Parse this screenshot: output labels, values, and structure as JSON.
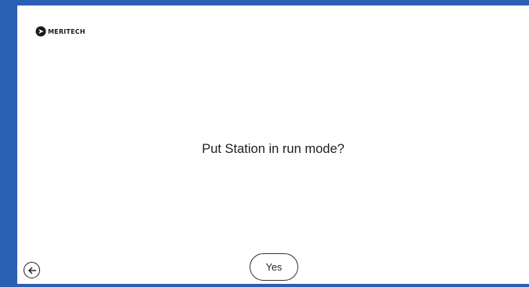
{
  "brand": {
    "name": "MERITECH",
    "icon": "meritech-logo-icon"
  },
  "dialog": {
    "question": "Put Station in run mode?",
    "confirm_label": "Yes"
  },
  "navigation": {
    "back_icon": "arrow-left-icon"
  },
  "colors": {
    "frame": "#2b5fb3",
    "background": "#ffffff",
    "text": "#1f1f1f"
  }
}
